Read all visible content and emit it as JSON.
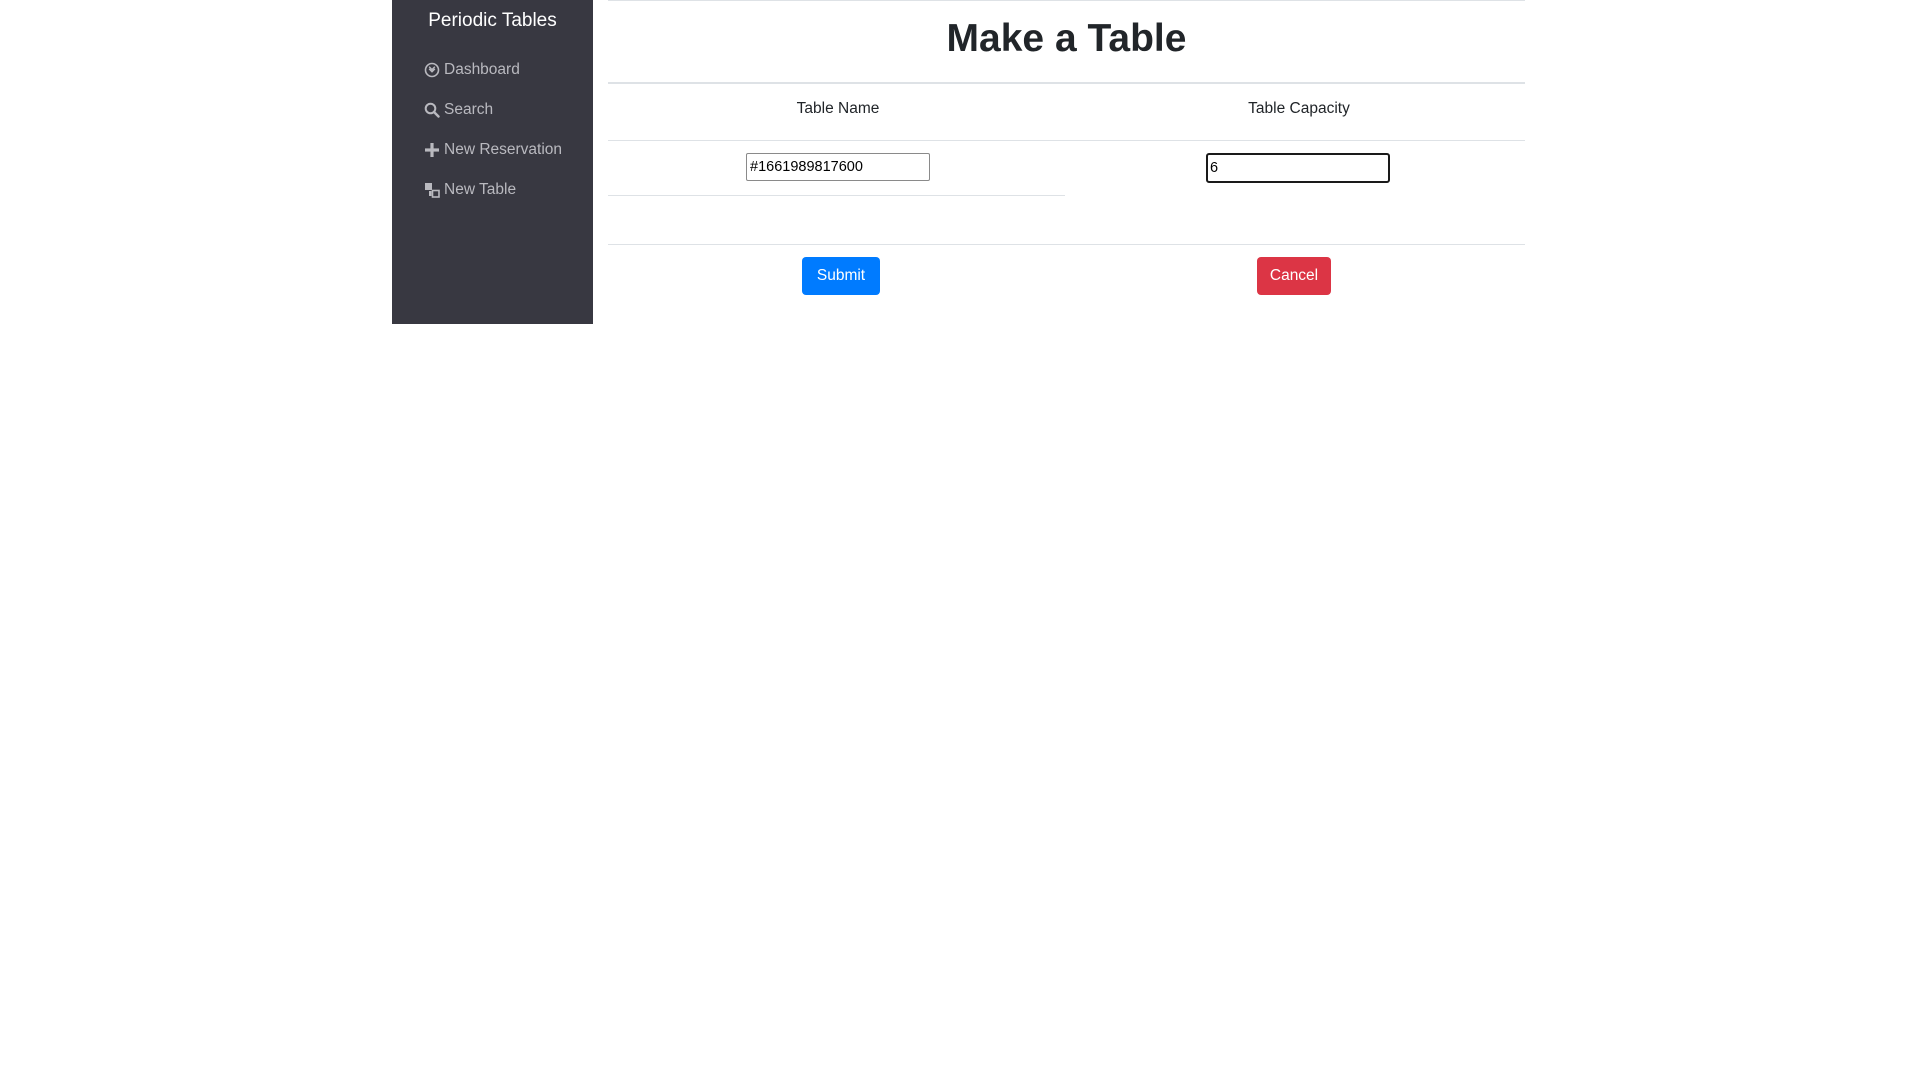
{
  "sidebar": {
    "brand": "Periodic Tables",
    "items": [
      {
        "label": "Dashboard",
        "icon": "dashboard-icon"
      },
      {
        "label": "Search",
        "icon": "search-icon"
      },
      {
        "label": "New Reservation",
        "icon": "plus-icon"
      },
      {
        "label": "New Table",
        "icon": "table-icon"
      }
    ]
  },
  "main": {
    "title": "Make a Table",
    "columns": {
      "name_header": "Table Name",
      "capacity_header": "Table Capacity"
    },
    "form": {
      "table_name_value": "#1661989817600",
      "table_capacity_value": "6"
    },
    "buttons": {
      "submit": "Submit",
      "cancel": "Cancel"
    }
  },
  "colors": {
    "sidebar_bg": "#383841",
    "submit": "#007bff",
    "cancel": "#dc3545"
  }
}
